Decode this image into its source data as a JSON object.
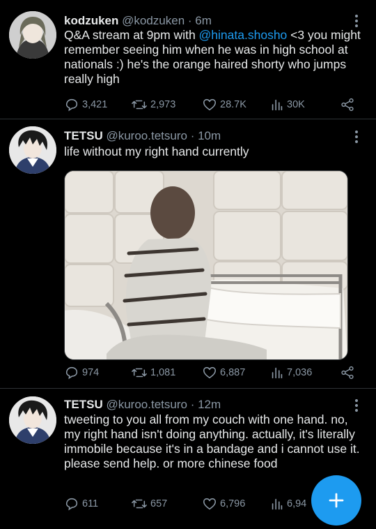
{
  "tweets": [
    {
      "name": "kodzuken",
      "handle": "@kodzuken",
      "time": "· 6m",
      "text_pre": "Q&A stream at 9pm with ",
      "mention": "@hinata.shosho",
      "text_post": " <3 you might remember seeing him when he was in high school at nationals :) he's the orange haired shorty who jumps really high",
      "replies": "3,421",
      "retweets": "2,973",
      "likes": "28.7K",
      "views": "30K"
    },
    {
      "name": "TETSU",
      "handle": "@kuroo.tetsuro",
      "time": "· 10m",
      "text": "life without my right hand currently",
      "replies": "974",
      "retweets": "1,081",
      "likes": "6,887",
      "views": "7,036"
    },
    {
      "name": "TETSU",
      "handle": "@kuroo.tetsuro",
      "time": "· 12m",
      "text": "tweeting to you all from my couch with one hand. no, my right hand isn't doing anything. actually, it's literally immobile because it's in a bandage and i cannot use it. please send help. or more chinese food",
      "replies": "611",
      "retweets": "657",
      "likes": "6,796",
      "views": "6,94"
    }
  ],
  "icons": {
    "reply": "reply-icon",
    "retweet": "retweet-icon",
    "like": "heart-icon",
    "views": "views-icon",
    "share": "share-icon",
    "more": "more-options-icon",
    "compose": "compose-plus-icon"
  },
  "colors": {
    "background": "#000000",
    "text": "#e7e9ea",
    "muted": "#8b98a5",
    "link": "#1d9bf0",
    "fab": "#1d9bf0",
    "divider": "#2f3336"
  }
}
